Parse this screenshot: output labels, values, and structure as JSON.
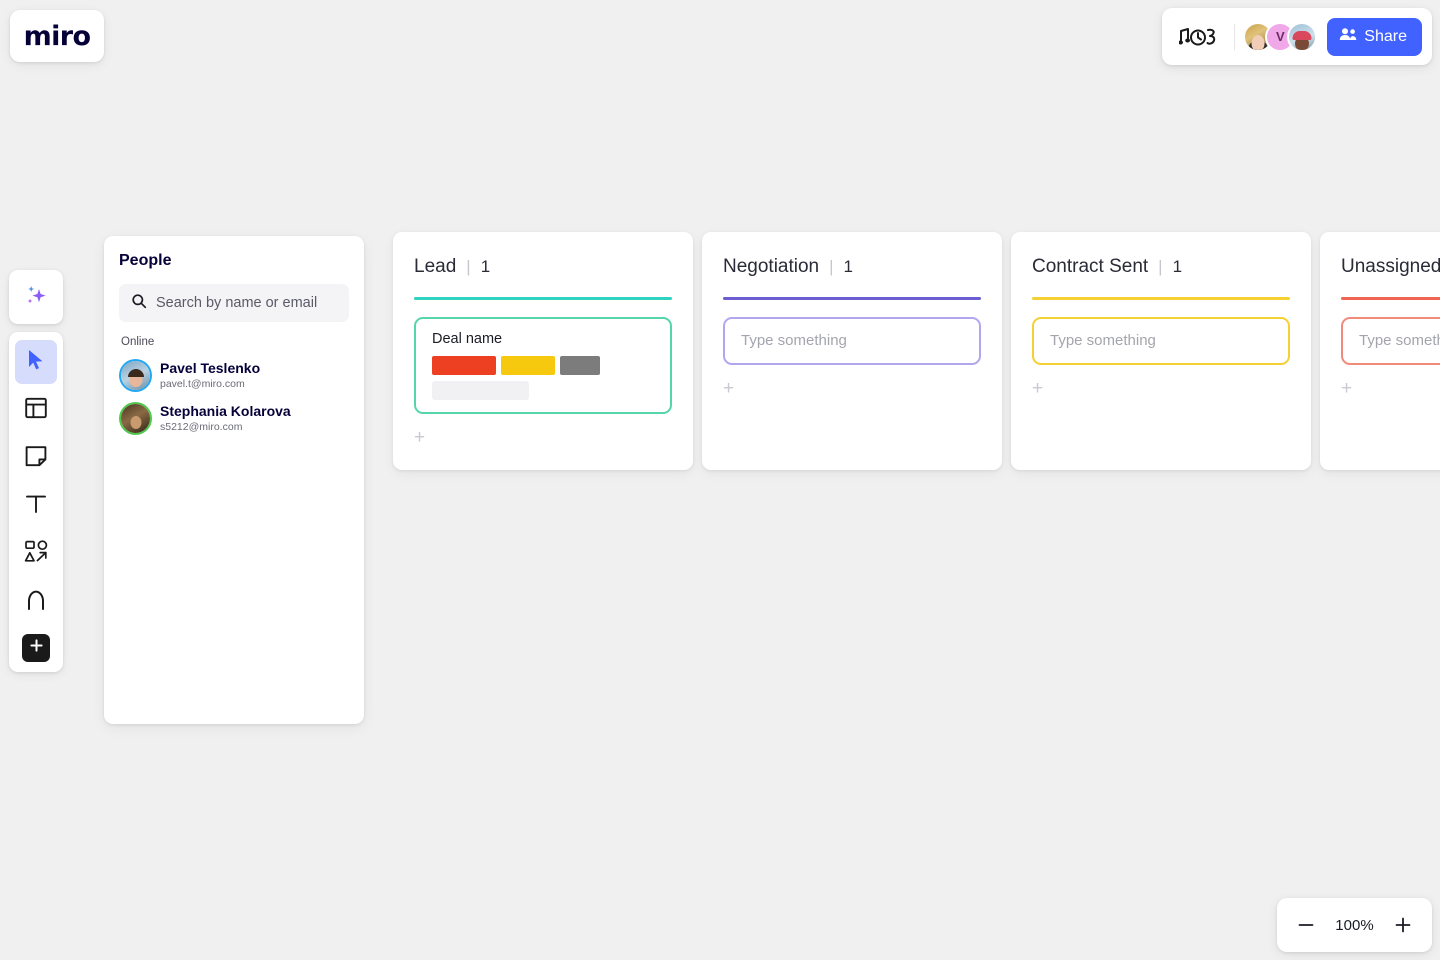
{
  "app": {
    "logo_text": "miro"
  },
  "topbar": {
    "timer_icon": "music-timer-icon",
    "collaborators": [
      {
        "name": "collaborator-1",
        "initial": "",
        "type": "photo"
      },
      {
        "name": "collaborator-2",
        "initial": "V",
        "type": "initial"
      },
      {
        "name": "collaborator-3",
        "initial": "",
        "type": "photo"
      }
    ],
    "share_label": "Share",
    "share_color": "#4262ff"
  },
  "toolbar": {
    "items": [
      {
        "name": "ai-sparkle",
        "icon": "sparkle-icon",
        "active": false
      },
      {
        "name": "select",
        "icon": "cursor-icon",
        "active": true
      },
      {
        "name": "templates",
        "icon": "frame-icon",
        "active": false
      },
      {
        "name": "sticky-note",
        "icon": "sticky-note-icon",
        "active": false
      },
      {
        "name": "text",
        "icon": "text-icon",
        "active": false
      },
      {
        "name": "shapes",
        "icon": "shapes-icon",
        "active": false
      },
      {
        "name": "pen",
        "icon": "pen-icon",
        "active": false
      },
      {
        "name": "more-apps",
        "icon": "plus-icon",
        "active": false
      }
    ]
  },
  "people_panel": {
    "title": "People",
    "search_placeholder": "Search by name or email",
    "search_value": "",
    "section_label": "Online",
    "people": [
      {
        "name": "Pavel Teslenko",
        "email": "pavel.t@miro.com",
        "ring": "#21a8f0"
      },
      {
        "name": "Stephania Kolarova",
        "email": "s5212@miro.com",
        "ring": "#4ec94e"
      }
    ]
  },
  "board": {
    "columns": [
      {
        "title": "Lead",
        "separator": "|",
        "count": "1",
        "accent": "#2fd3c0",
        "card_border": "#56d6a8",
        "card": {
          "type": "deal",
          "title": "Deal name",
          "chips": [
            {
              "label": "",
              "color": "#ed4023"
            },
            {
              "label": "",
              "color": "#f6c90e"
            },
            {
              "label": "",
              "color": "#7c7c7c"
            }
          ],
          "placeholder_bar": true
        },
        "add_label": "+"
      },
      {
        "title": "Negotiation",
        "separator": "|",
        "count": "1",
        "accent": "#6a5ed0",
        "card_border": "#b0a7f0",
        "card": {
          "type": "empty",
          "placeholder": "Type something"
        },
        "add_label": "+"
      },
      {
        "title": "Contract Sent",
        "separator": "|",
        "count": "1",
        "accent": "#f5d033",
        "card_border": "#f5d033",
        "card": {
          "type": "empty",
          "placeholder": "Type something"
        },
        "add_label": "+"
      },
      {
        "title": "Unassigned Task",
        "separator": "",
        "count": "",
        "accent": "#f06552",
        "card_border": "#f28a7c",
        "card": {
          "type": "empty",
          "placeholder": "Type something"
        },
        "add_label": "+"
      }
    ]
  },
  "zoom_control": {
    "zoom_out_label": "−",
    "level": "100%",
    "zoom_in_label": "+"
  }
}
